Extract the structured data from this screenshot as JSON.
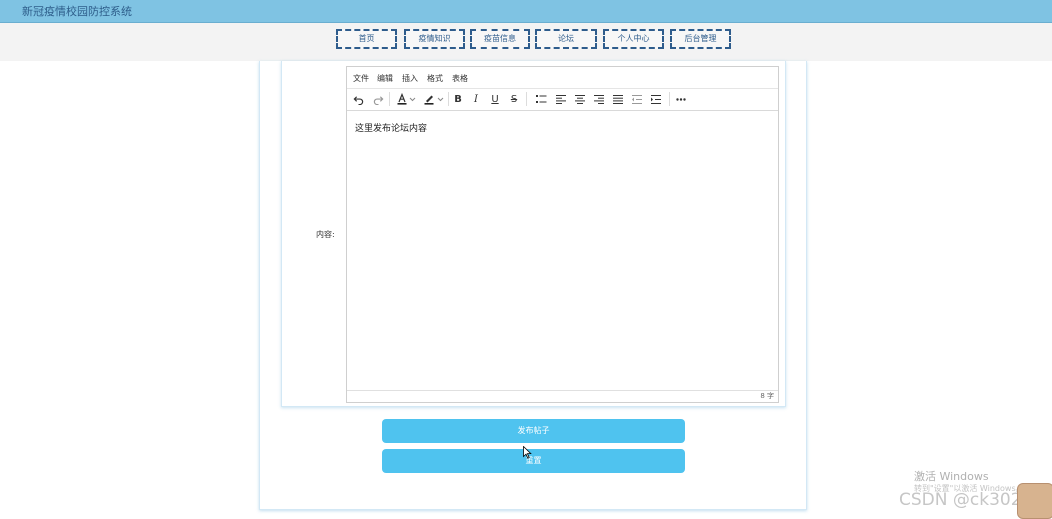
{
  "app": {
    "title": "新冠疫情校园防控系统"
  },
  "nav": {
    "items": [
      {
        "label": "首页"
      },
      {
        "label": "疫情知识"
      },
      {
        "label": "疫苗信息"
      },
      {
        "label": "论坛"
      },
      {
        "label": "个人中心"
      },
      {
        "label": "后台管理"
      }
    ]
  },
  "form": {
    "content_label": "内容:",
    "editor": {
      "menu": [
        "文件",
        "编辑",
        "插入",
        "格式",
        "表格"
      ],
      "toolbar_icons": [
        "undo-icon",
        "redo-icon",
        "text-color-icon",
        "highlight-color-icon",
        "bold-icon",
        "italic-icon",
        "underline-icon",
        "strikethrough-icon",
        "bullet-list-icon",
        "align-left-icon",
        "align-center-icon",
        "align-right-icon",
        "align-justify-icon",
        "outdent-icon",
        "indent-icon",
        "more-icon"
      ],
      "content": "这里发布论坛内容",
      "word_count": "8 字"
    },
    "submit_label": "发布帖子",
    "reset_label": "重置"
  },
  "watermark": {
    "windows_title": "激活 Windows",
    "windows_sub": "转到\"设置\"以激活 Windows。",
    "csdn": "CSDN @ck3021"
  },
  "colors": {
    "topbar": "#7fc3e3",
    "nav_border": "#2e5c8c",
    "button": "#4fc3ef"
  }
}
